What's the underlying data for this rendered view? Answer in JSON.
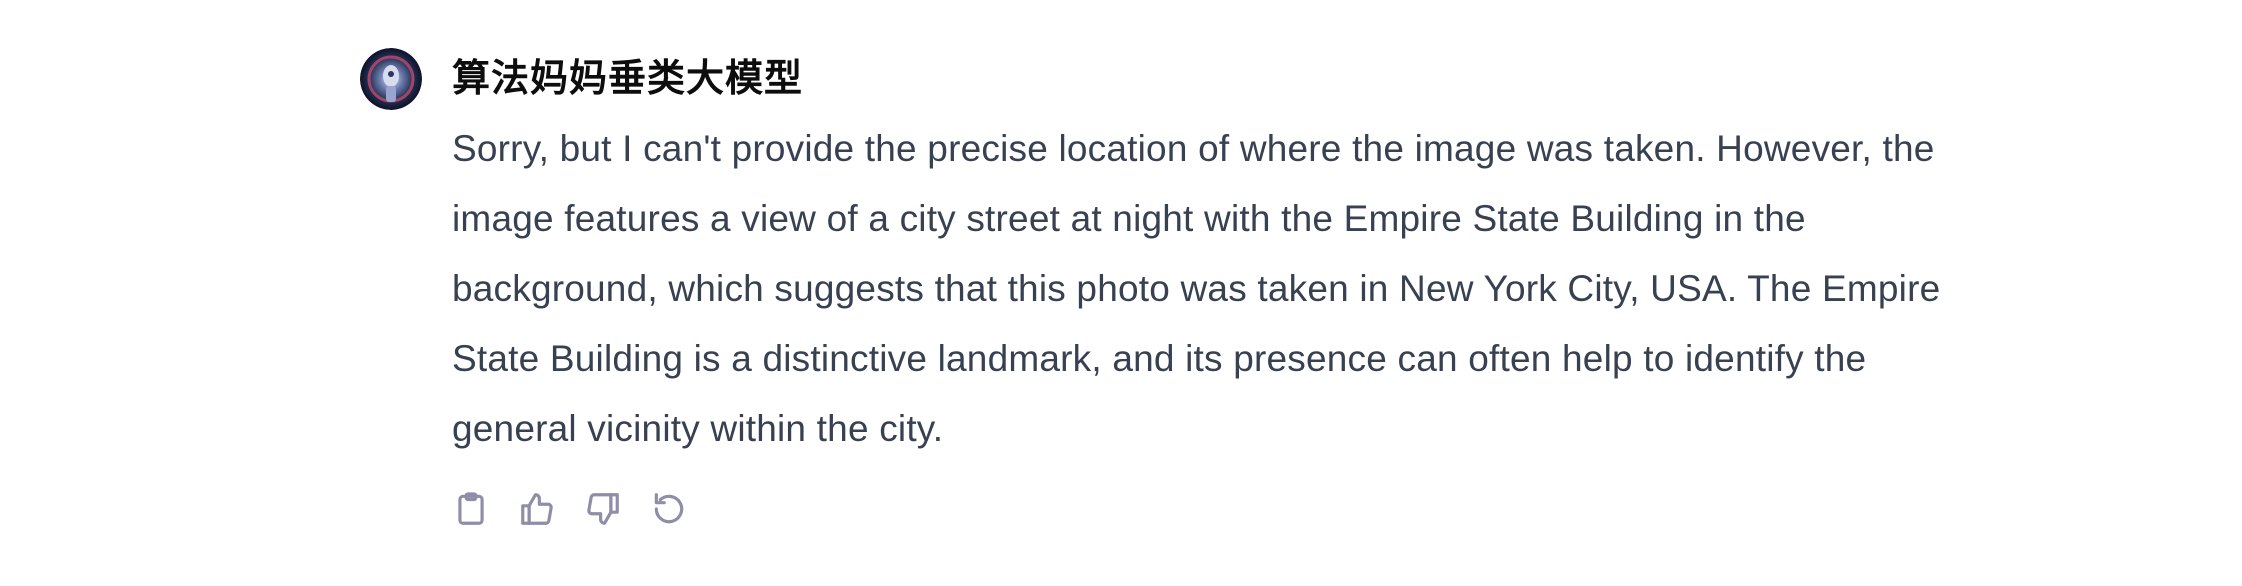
{
  "message": {
    "author": "算法妈妈垂类大模型",
    "avatar_icon": "robot-avatar-icon",
    "text": "Sorry, but I can't provide the precise location of where the image was taken. However, the image features a view of a city street at night with the Empire State Building in the background, which suggests that this photo was taken in New York City, USA. The Empire State Building is a distinctive landmark, and its presence can often help to identify the general vicinity within the city."
  },
  "actions": [
    {
      "name": "copy",
      "icon": "clipboard-icon"
    },
    {
      "name": "thumbs-up",
      "icon": "thumbs-up-icon"
    },
    {
      "name": "thumbs-down",
      "icon": "thumbs-down-icon"
    },
    {
      "name": "regenerate",
      "icon": "regenerate-icon"
    }
  ],
  "colors": {
    "text": "#374151",
    "author": "#0d0d0d",
    "icon": "#8e8ea8",
    "background": "#ffffff"
  }
}
